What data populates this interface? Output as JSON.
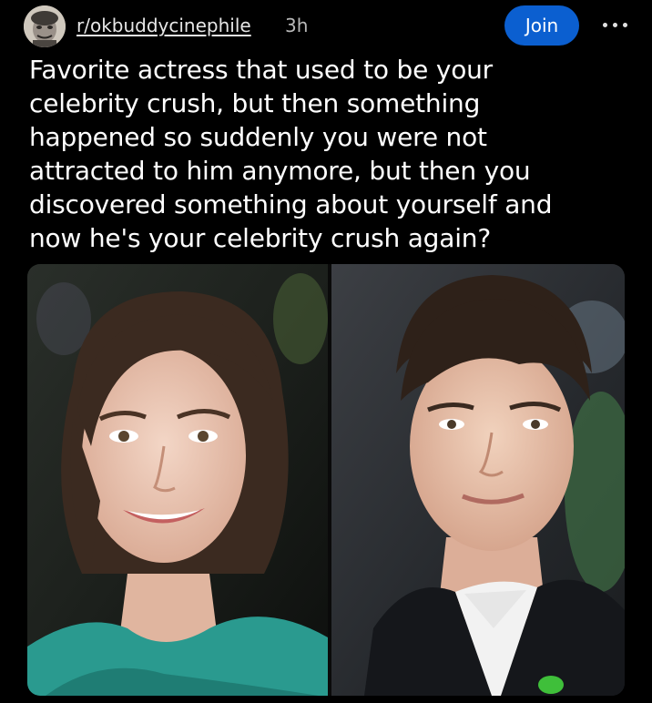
{
  "post": {
    "subreddit": "r/okbuddycinephile",
    "time": "3h",
    "join_label": "Join",
    "title_lines": [
      "Favorite actress that used to be your",
      "celebrity crush, but then something",
      "happened so suddenly you were not",
      "attracted to him anymore, but then you",
      "discovered something about yourself and",
      "now he's your celebrity crush again?"
    ]
  },
  "icons": {
    "avatar": "avatar-icon",
    "more": "more-options-icon"
  },
  "colors": {
    "background": "#000000",
    "join_button": "#0b5fd0",
    "text": "#ffffff",
    "muted": "#b8b8b8"
  }
}
